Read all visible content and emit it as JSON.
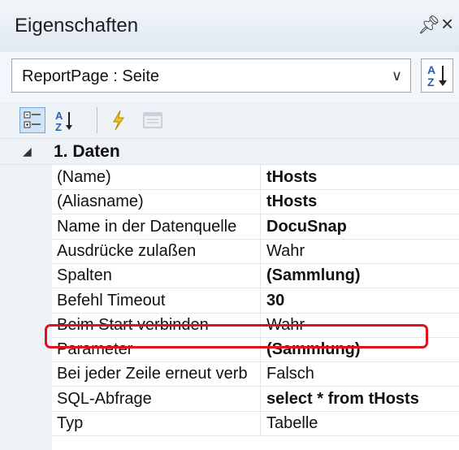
{
  "panel": {
    "title": "Eigenschaften",
    "pin_icon": "pin-icon",
    "close_icon": "close-icon"
  },
  "selector": {
    "value": "ReportPage : Seite",
    "dropdown_icon": "chevron-down-icon",
    "sort_icon": "sort-az-icon"
  },
  "toolbar": {
    "buttons": [
      {
        "icon": "categorized-icon",
        "active": true
      },
      {
        "icon": "sort-az-icon",
        "active": false
      },
      {
        "icon": "lightning-events-icon",
        "active": false
      },
      {
        "icon": "property-pages-icon",
        "active": false
      }
    ]
  },
  "grid": {
    "category": "1. Daten",
    "properties": [
      {
        "name": "(Name)",
        "value": "tHosts",
        "bold": true
      },
      {
        "name": "(Aliasname)",
        "value": "tHosts",
        "bold": true
      },
      {
        "name": "Name in der Datenquelle",
        "value": "DocuSnap",
        "bold": true
      },
      {
        "name": "Ausdrücke zulaßen",
        "value": "Wahr",
        "bold": false
      },
      {
        "name": "Spalten",
        "value": "(Sammlung)",
        "bold": true
      },
      {
        "name": "Befehl Timeout",
        "value": "30",
        "bold": true
      },
      {
        "name": "Beim Start verbinden",
        "value": "Wahr",
        "bold": false,
        "highlighted": true
      },
      {
        "name": "Parameter",
        "value": "(Sammlung)",
        "bold": true
      },
      {
        "name": "Bei jeder Zeile erneut verb",
        "value": "Falsch",
        "bold": false
      },
      {
        "name": "SQL-Abfrage",
        "value": "select * from tHosts",
        "bold": true
      },
      {
        "name": "Typ",
        "value": "Tabelle",
        "bold": false
      }
    ]
  },
  "colors": {
    "highlight": "#e0101e",
    "titlebar": "#dfe8f2",
    "accent": "#7ba7d6"
  }
}
